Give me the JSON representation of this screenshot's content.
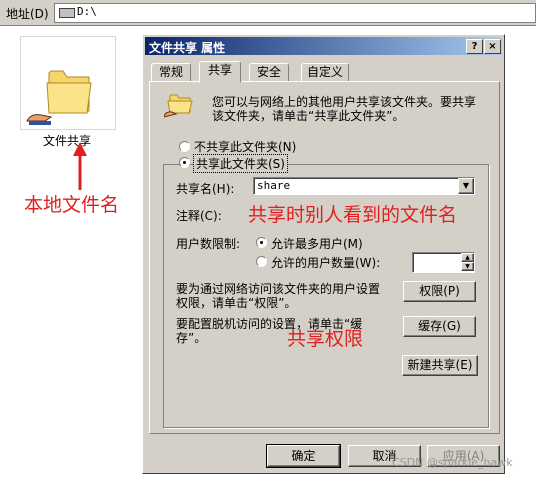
{
  "address_bar": {
    "label": "地址(D)",
    "path": "D:\\"
  },
  "desktop": {
    "folder_label": "文件共享"
  },
  "annotations": {
    "local_name": "本地文件名",
    "share_name_note": "共享时别人看到的文件名",
    "permissions_note": "共享权限"
  },
  "dialog": {
    "title": "文件共享 属性",
    "help_btn": "?",
    "close_btn": "×",
    "tabs": [
      "常规",
      "共享",
      "安全",
      "自定义"
    ],
    "intro_text_1": "您可以与网络上的其他用户共享该文件夹。要共享",
    "intro_text_2": "该文件夹，请单击“共享此文件夹”。",
    "radio_not_share": "不共享此文件夹(N)",
    "radio_share": "共享此文件夹(S)",
    "share_name_label": "共享名(H):",
    "share_name_value": "share",
    "comment_label": "注释(C):",
    "user_limit_label": "用户数限制:",
    "radio_max_users": "允许最多用户(M)",
    "radio_allowed_users": "允许的用户数量(W):",
    "perm_text_1": "要为通过网络访问该文件夹的用户设置",
    "perm_text_2": "权限，请单击“权限”。",
    "perm_btn": "权限(P)",
    "cache_text_1": "要配置脱机访问的设置，请单击“缓",
    "cache_text_2": "存”。",
    "cache_btn": "缓存(G)",
    "new_share_btn": "新建共享(E)",
    "ok_btn": "确定",
    "cancel_btn": "取消",
    "apply_btn": "应用(A)"
  },
  "watermark": "CSDN @sparkle_hawk",
  "colors": {
    "annotation": "#e02020",
    "titlebar": "#0a246a",
    "face": "#d4d0c8"
  }
}
